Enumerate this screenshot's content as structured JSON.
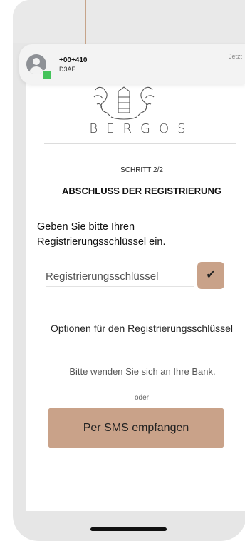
{
  "notification": {
    "sender": "+00+410",
    "code": "D3AE",
    "time": "Jetzt"
  },
  "brand": "BERGOS",
  "step_label": "SCHRITT 2/2",
  "title": "ABSCHLUSS DER REGISTRIERUNG",
  "instruction": "Geben Sie bitte Ihren Registrierungsschlüssel ein.",
  "key_input": {
    "placeholder": "Registrierungsschlüssel",
    "value": ""
  },
  "options_title": "Optionen für den Registrierungsschlüssel",
  "contact_text": "Bitte wenden Sie sich an Ihre Bank.",
  "or_text": "oder",
  "sms_button_label": "Per SMS empfangen",
  "colors": {
    "accent": "#c9a289",
    "guide_line": "#c6a48a",
    "badge_green": "#44c35a"
  },
  "icons": {
    "avatar": "person-avatar-icon",
    "badge": "messages-app-icon",
    "check": "checkmark-icon",
    "logo": "bergos-lions-crest"
  }
}
